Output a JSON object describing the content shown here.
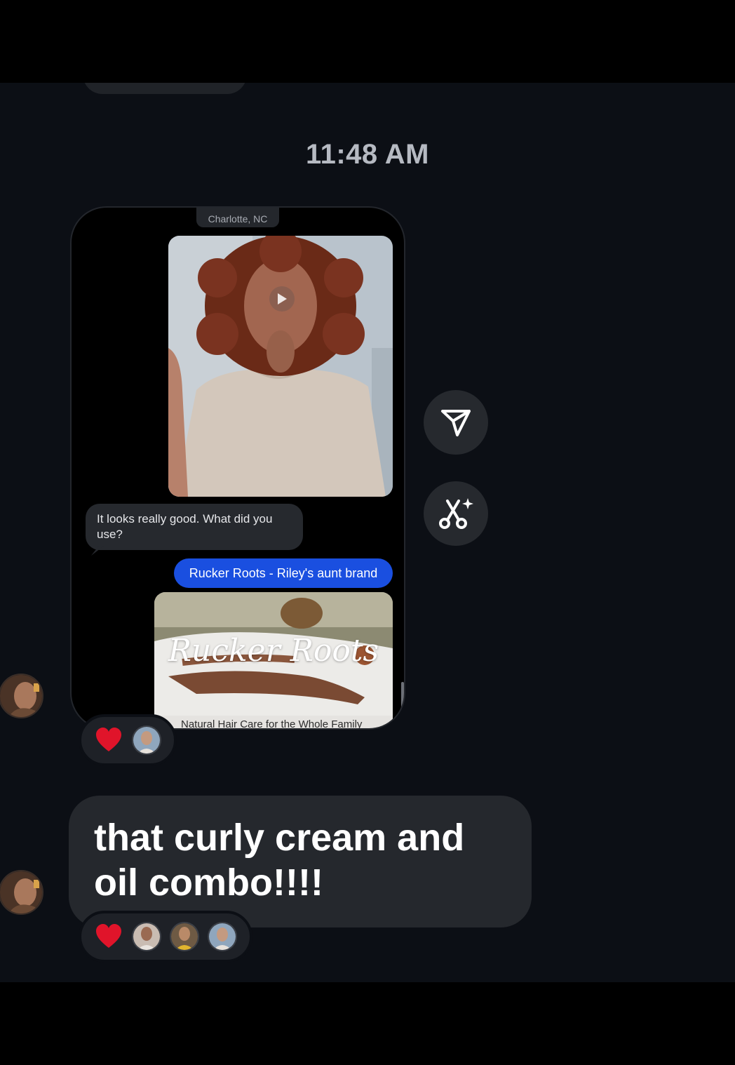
{
  "conversation": {
    "timestamp": "11:48 AM",
    "shared_screenshot": {
      "location_label": "Charlotte, NC",
      "received_message": "It looks really good. What did you use?",
      "sent_message": "Rucker Roots - Riley's aunt brand",
      "link_card": {
        "brand_logo_text": "Rucker Roots",
        "tagline": "Natural Hair Care for the Whole Family"
      }
    },
    "message_text": "that curly cream and oil combo!!!!",
    "reactions_1": {
      "emoji": "heart",
      "count_avatars": 1
    },
    "reactions_2": {
      "emoji": "heart",
      "count_avatars": 3
    }
  },
  "actions": {
    "share_icon": "send-icon",
    "ai_edit_icon": "scissors-sparkle-icon"
  },
  "colors": {
    "background": "#0c0f15",
    "bubble_received": "#25282d",
    "bubble_sent": "#1a4fe0",
    "heart": "#e0142a"
  }
}
